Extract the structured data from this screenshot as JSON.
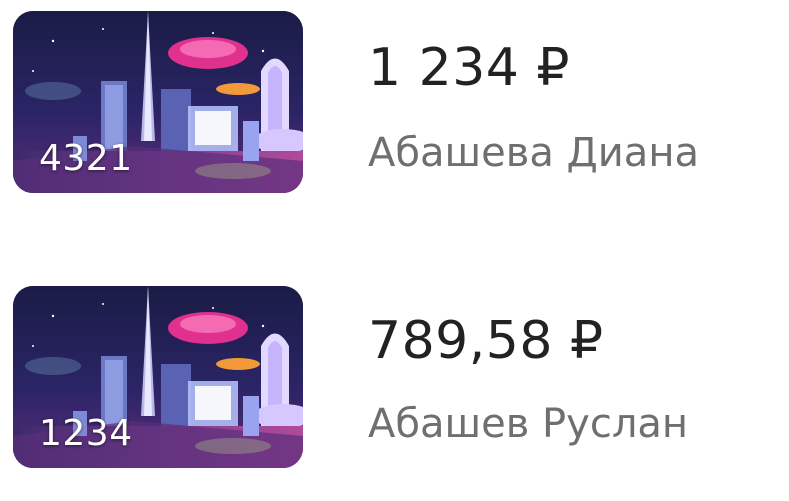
{
  "accounts": [
    {
      "card_number": "4321",
      "amount": "1 234 ₽",
      "holder_name": "Абашева Диана"
    },
    {
      "card_number": "1234",
      "amount": "789,58 ₽",
      "holder_name": "Абашев Руслан"
    }
  ],
  "colors": {
    "amount_text": "#222222",
    "holder_text": "#6f6f6f",
    "card_sky": "#1b1f47",
    "card_accent_pink": "#e0318f",
    "card_accent_orange": "#f29a3a",
    "card_accent_purple": "#8a5bd6"
  },
  "card_art": "futuristic-city-card-art"
}
